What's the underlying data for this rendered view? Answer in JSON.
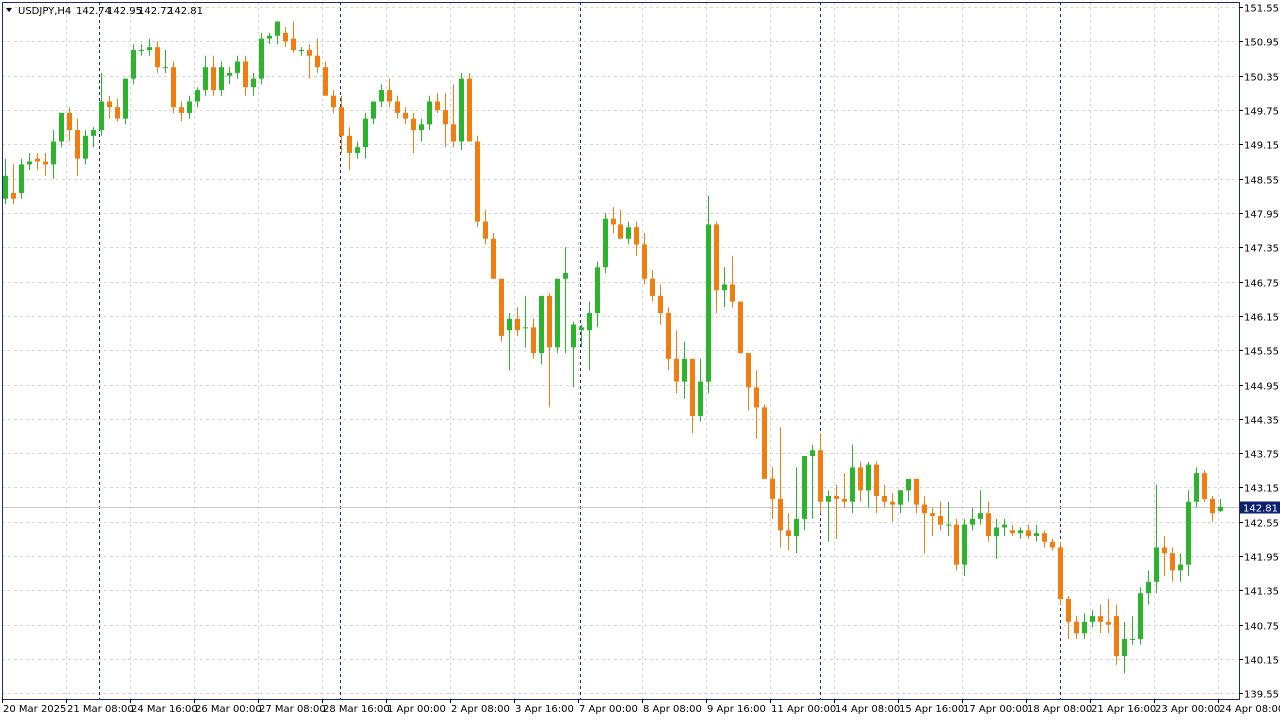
{
  "header": {
    "symbol_timeframe": "USDJPY,H4",
    "open": "142.74",
    "high": "142.95",
    "low": "142.72",
    "close": "142.81"
  },
  "colors": {
    "bull": "#2db42d",
    "bear": "#f07d0f",
    "grid": "#d9d9d9",
    "separator": "#1a2a7a",
    "price_label_bg": "#0b1f6e",
    "frame": "#1a2a7a"
  },
  "chart_data": {
    "type": "candlestick",
    "title": "USDJPY,H4",
    "ylim": [
      139.5,
      151.6
    ],
    "grid": true,
    "last_price": 142.81,
    "y_ticks": [
      "151.55",
      "150.95",
      "150.35",
      "149.75",
      "149.15",
      "148.55",
      "147.95",
      "147.35",
      "146.75",
      "146.15",
      "145.55",
      "144.95",
      "144.35",
      "143.75",
      "143.15",
      "142.55",
      "141.95",
      "141.35",
      "140.75",
      "140.15",
      "139.55"
    ],
    "x_labels": [
      "20 Mar 2025",
      "21 Mar 08:00",
      "24 Mar 16:00",
      "26 Mar 00:00",
      "27 Mar 08:00",
      "28 Mar 16:00",
      "1 Apr 00:00",
      "2 Apr 08:00",
      "3 Apr 16:00",
      "7 Apr 00:00",
      "8 Apr 08:00",
      "9 Apr 16:00",
      "11 Apr 00:00",
      "14 Apr 08:00",
      "15 Apr 16:00",
      "17 Apr 00:00",
      "18 Apr 08:00",
      "21 Apr 16:00",
      "23 Apr 00:00",
      "24 Apr 08:00"
    ],
    "candles": [
      {
        "o": 148.2,
        "h": 148.9,
        "l": 148.1,
        "c": 148.6
      },
      {
        "o": 148.3,
        "h": 148.8,
        "l": 148.1,
        "c": 148.2
      },
      {
        "o": 148.3,
        "h": 148.9,
        "l": 148.2,
        "c": 148.8
      },
      {
        "o": 148.8,
        "h": 149.0,
        "l": 148.7,
        "c": 148.85
      },
      {
        "o": 148.9,
        "h": 149.0,
        "l": 148.7,
        "c": 148.85
      },
      {
        "o": 148.85,
        "h": 149.0,
        "l": 148.6,
        "c": 148.8
      },
      {
        "o": 148.8,
        "h": 149.4,
        "l": 148.55,
        "c": 149.2
      },
      {
        "o": 149.2,
        "h": 149.7,
        "l": 149.1,
        "c": 149.7
      },
      {
        "o": 149.7,
        "h": 149.8,
        "l": 149.2,
        "c": 149.4
      },
      {
        "o": 149.4,
        "h": 149.6,
        "l": 148.6,
        "c": 148.9
      },
      {
        "o": 148.9,
        "h": 149.4,
        "l": 148.8,
        "c": 149.3
      },
      {
        "o": 149.3,
        "h": 149.45,
        "l": 149.1,
        "c": 149.4
      },
      {
        "o": 149.4,
        "h": 150.4,
        "l": 149.3,
        "c": 149.9
      },
      {
        "o": 149.9,
        "h": 150.0,
        "l": 149.6,
        "c": 149.8
      },
      {
        "o": 149.8,
        "h": 149.95,
        "l": 149.55,
        "c": 149.6
      },
      {
        "o": 149.6,
        "h": 150.3,
        "l": 149.5,
        "c": 150.3
      },
      {
        "o": 150.3,
        "h": 150.9,
        "l": 150.2,
        "c": 150.8
      },
      {
        "o": 150.8,
        "h": 150.9,
        "l": 150.7,
        "c": 150.8
      },
      {
        "o": 150.8,
        "h": 151.0,
        "l": 150.7,
        "c": 150.85
      },
      {
        "o": 150.85,
        "h": 150.95,
        "l": 150.4,
        "c": 150.5
      },
      {
        "o": 150.5,
        "h": 150.8,
        "l": 150.4,
        "c": 150.5
      },
      {
        "o": 150.5,
        "h": 150.6,
        "l": 149.7,
        "c": 149.8
      },
      {
        "o": 149.8,
        "h": 149.9,
        "l": 149.55,
        "c": 149.7
      },
      {
        "o": 149.7,
        "h": 150.0,
        "l": 149.6,
        "c": 149.9
      },
      {
        "o": 149.9,
        "h": 150.15,
        "l": 149.8,
        "c": 150.1
      },
      {
        "o": 150.1,
        "h": 150.7,
        "l": 150.0,
        "c": 150.5
      },
      {
        "o": 150.5,
        "h": 150.7,
        "l": 150.0,
        "c": 150.1
      },
      {
        "o": 150.1,
        "h": 150.6,
        "l": 150.0,
        "c": 150.5
      },
      {
        "o": 150.35,
        "h": 150.5,
        "l": 150.2,
        "c": 150.4
      },
      {
        "o": 150.4,
        "h": 150.7,
        "l": 150.3,
        "c": 150.6
      },
      {
        "o": 150.6,
        "h": 150.7,
        "l": 150.0,
        "c": 150.15
      },
      {
        "o": 150.15,
        "h": 150.4,
        "l": 150.0,
        "c": 150.3
      },
      {
        "o": 150.3,
        "h": 151.1,
        "l": 150.2,
        "c": 151.0
      },
      {
        "o": 151.0,
        "h": 151.1,
        "l": 150.9,
        "c": 151.05
      },
      {
        "o": 151.05,
        "h": 151.3,
        "l": 150.9,
        "c": 151.3
      },
      {
        "o": 151.1,
        "h": 151.2,
        "l": 150.85,
        "c": 150.95
      },
      {
        "o": 151.0,
        "h": 151.3,
        "l": 150.75,
        "c": 150.8
      },
      {
        "o": 150.8,
        "h": 150.85,
        "l": 150.7,
        "c": 150.8
      },
      {
        "o": 150.8,
        "h": 150.9,
        "l": 150.3,
        "c": 150.7
      },
      {
        "o": 150.7,
        "h": 151.0,
        "l": 150.4,
        "c": 150.5
      },
      {
        "o": 150.5,
        "h": 150.6,
        "l": 150.0,
        "c": 150.0
      },
      {
        "o": 150.0,
        "h": 150.1,
        "l": 149.7,
        "c": 149.8
      },
      {
        "o": 149.8,
        "h": 150.0,
        "l": 149.0,
        "c": 149.3
      },
      {
        "o": 149.3,
        "h": 149.45,
        "l": 148.7,
        "c": 149.0
      },
      {
        "o": 149.0,
        "h": 149.2,
        "l": 148.9,
        "c": 149.1
      },
      {
        "o": 149.1,
        "h": 149.7,
        "l": 148.9,
        "c": 149.6
      },
      {
        "o": 149.6,
        "h": 149.9,
        "l": 149.5,
        "c": 149.9
      },
      {
        "o": 149.9,
        "h": 150.2,
        "l": 149.8,
        "c": 150.1
      },
      {
        "o": 150.1,
        "h": 150.3,
        "l": 149.8,
        "c": 149.9
      },
      {
        "o": 149.9,
        "h": 150.0,
        "l": 149.6,
        "c": 149.7
      },
      {
        "o": 149.7,
        "h": 149.8,
        "l": 149.5,
        "c": 149.6
      },
      {
        "o": 149.6,
        "h": 149.7,
        "l": 149.0,
        "c": 149.4
      },
      {
        "o": 149.4,
        "h": 149.6,
        "l": 149.2,
        "c": 149.5
      },
      {
        "o": 149.5,
        "h": 150.0,
        "l": 149.4,
        "c": 149.9
      },
      {
        "o": 149.9,
        "h": 150.05,
        "l": 149.7,
        "c": 149.75
      },
      {
        "o": 149.75,
        "h": 150.05,
        "l": 149.1,
        "c": 149.5
      },
      {
        "o": 149.5,
        "h": 150.2,
        "l": 149.1,
        "c": 149.2
      },
      {
        "o": 149.2,
        "h": 150.4,
        "l": 149.05,
        "c": 150.3
      },
      {
        "o": 150.3,
        "h": 150.4,
        "l": 149.2,
        "c": 149.2
      },
      {
        "o": 149.2,
        "h": 149.3,
        "l": 147.7,
        "c": 147.8
      },
      {
        "o": 147.8,
        "h": 148.0,
        "l": 147.4,
        "c": 147.5
      },
      {
        "o": 147.5,
        "h": 147.6,
        "l": 146.8,
        "c": 146.8
      },
      {
        "o": 146.8,
        "h": 146.8,
        "l": 145.7,
        "c": 145.8
      },
      {
        "o": 145.9,
        "h": 146.2,
        "l": 145.2,
        "c": 146.1
      },
      {
        "o": 146.1,
        "h": 146.3,
        "l": 145.8,
        "c": 145.9
      },
      {
        "o": 145.95,
        "h": 146.5,
        "l": 145.6,
        "c": 145.95
      },
      {
        "o": 145.95,
        "h": 146.1,
        "l": 145.4,
        "c": 145.5
      },
      {
        "o": 145.5,
        "h": 146.5,
        "l": 145.3,
        "c": 146.5
      },
      {
        "o": 146.5,
        "h": 146.55,
        "l": 144.55,
        "c": 145.6
      },
      {
        "o": 145.6,
        "h": 146.8,
        "l": 145.5,
        "c": 146.8
      },
      {
        "o": 146.8,
        "h": 147.35,
        "l": 145.5,
        "c": 146.9
      },
      {
        "o": 145.6,
        "h": 146.05,
        "l": 144.9,
        "c": 146.0
      },
      {
        "o": 145.9,
        "h": 146.0,
        "l": 145.6,
        "c": 145.95
      },
      {
        "o": 145.9,
        "h": 146.4,
        "l": 145.2,
        "c": 146.2
      },
      {
        "o": 146.2,
        "h": 147.1,
        "l": 145.95,
        "c": 147.0
      },
      {
        "o": 147.0,
        "h": 147.95,
        "l": 146.9,
        "c": 147.85
      },
      {
        "o": 147.85,
        "h": 148.05,
        "l": 147.6,
        "c": 147.75
      },
      {
        "o": 147.75,
        "h": 148.0,
        "l": 147.5,
        "c": 147.5
      },
      {
        "o": 147.5,
        "h": 147.8,
        "l": 147.4,
        "c": 147.7
      },
      {
        "o": 147.7,
        "h": 147.8,
        "l": 147.2,
        "c": 147.4
      },
      {
        "o": 147.4,
        "h": 147.6,
        "l": 146.7,
        "c": 146.8
      },
      {
        "o": 146.8,
        "h": 146.95,
        "l": 146.4,
        "c": 146.5
      },
      {
        "o": 146.5,
        "h": 146.7,
        "l": 146.0,
        "c": 146.2
      },
      {
        "o": 146.2,
        "h": 146.3,
        "l": 145.2,
        "c": 145.4
      },
      {
        "o": 145.4,
        "h": 145.9,
        "l": 144.8,
        "c": 145.0
      },
      {
        "o": 145.0,
        "h": 145.7,
        "l": 144.7,
        "c": 145.4
      },
      {
        "o": 145.4,
        "h": 145.4,
        "l": 144.1,
        "c": 144.4
      },
      {
        "o": 144.4,
        "h": 145.4,
        "l": 144.3,
        "c": 145.0
      },
      {
        "o": 145.0,
        "h": 148.25,
        "l": 144.8,
        "c": 147.75
      },
      {
        "o": 147.75,
        "h": 147.8,
        "l": 146.2,
        "c": 146.6
      },
      {
        "o": 146.6,
        "h": 147.0,
        "l": 146.3,
        "c": 146.7
      },
      {
        "o": 146.7,
        "h": 147.2,
        "l": 146.3,
        "c": 146.4
      },
      {
        "o": 146.4,
        "h": 146.4,
        "l": 145.5,
        "c": 145.5
      },
      {
        "o": 145.5,
        "h": 145.5,
        "l": 144.5,
        "c": 144.9
      },
      {
        "o": 144.9,
        "h": 145.2,
        "l": 144.0,
        "c": 144.55
      },
      {
        "o": 144.55,
        "h": 144.6,
        "l": 143.3,
        "c": 143.3
      },
      {
        "o": 143.3,
        "h": 143.5,
        "l": 142.6,
        "c": 142.95
      },
      {
        "o": 142.95,
        "h": 144.2,
        "l": 142.1,
        "c": 142.4
      },
      {
        "o": 142.4,
        "h": 142.7,
        "l": 142.05,
        "c": 142.3
      },
      {
        "o": 142.3,
        "h": 143.5,
        "l": 142.0,
        "c": 142.6
      },
      {
        "o": 142.6,
        "h": 143.7,
        "l": 142.4,
        "c": 143.7
      },
      {
        "o": 143.7,
        "h": 143.9,
        "l": 142.6,
        "c": 143.8
      },
      {
        "o": 143.8,
        "h": 144.1,
        "l": 142.7,
        "c": 142.9
      },
      {
        "o": 142.9,
        "h": 143.1,
        "l": 142.2,
        "c": 143.0
      },
      {
        "o": 143.0,
        "h": 143.2,
        "l": 142.25,
        "c": 142.95
      },
      {
        "o": 142.95,
        "h": 143.4,
        "l": 142.8,
        "c": 142.9
      },
      {
        "o": 142.9,
        "h": 143.9,
        "l": 142.7,
        "c": 143.5
      },
      {
        "o": 143.5,
        "h": 143.6,
        "l": 142.9,
        "c": 143.1
      },
      {
        "o": 143.1,
        "h": 143.6,
        "l": 142.8,
        "c": 143.55
      },
      {
        "o": 143.55,
        "h": 143.6,
        "l": 142.7,
        "c": 143.0
      },
      {
        "o": 143.0,
        "h": 143.2,
        "l": 142.8,
        "c": 142.9
      },
      {
        "o": 142.9,
        "h": 143.05,
        "l": 142.55,
        "c": 142.85
      },
      {
        "o": 142.85,
        "h": 143.1,
        "l": 142.7,
        "c": 143.1
      },
      {
        "o": 143.1,
        "h": 143.3,
        "l": 142.9,
        "c": 143.3
      },
      {
        "o": 143.3,
        "h": 143.3,
        "l": 142.7,
        "c": 142.85
      },
      {
        "o": 142.85,
        "h": 143.0,
        "l": 142.0,
        "c": 142.7
      },
      {
        "o": 142.7,
        "h": 142.8,
        "l": 142.3,
        "c": 142.65
      },
      {
        "o": 142.65,
        "h": 142.9,
        "l": 142.4,
        "c": 142.5
      },
      {
        "o": 142.5,
        "h": 142.9,
        "l": 142.3,
        "c": 142.5
      },
      {
        "o": 142.5,
        "h": 142.6,
        "l": 141.7,
        "c": 141.8
      },
      {
        "o": 141.8,
        "h": 142.6,
        "l": 141.6,
        "c": 142.5
      },
      {
        "o": 142.5,
        "h": 142.8,
        "l": 142.4,
        "c": 142.6
      },
      {
        "o": 142.6,
        "h": 143.1,
        "l": 142.5,
        "c": 142.7
      },
      {
        "o": 142.7,
        "h": 142.9,
        "l": 142.2,
        "c": 142.3
      },
      {
        "o": 142.3,
        "h": 142.6,
        "l": 141.9,
        "c": 142.45
      },
      {
        "o": 142.45,
        "h": 142.6,
        "l": 142.3,
        "c": 142.5
      },
      {
        "o": 142.4,
        "h": 142.5,
        "l": 142.3,
        "c": 142.35
      },
      {
        "o": 142.35,
        "h": 142.45,
        "l": 142.25,
        "c": 142.4
      },
      {
        "o": 142.4,
        "h": 142.5,
        "l": 142.25,
        "c": 142.3
      },
      {
        "o": 142.3,
        "h": 142.5,
        "l": 142.2,
        "c": 142.35
      },
      {
        "o": 142.35,
        "h": 142.4,
        "l": 142.1,
        "c": 142.2
      },
      {
        "o": 142.2,
        "h": 142.25,
        "l": 142.05,
        "c": 142.1
      },
      {
        "o": 142.1,
        "h": 142.2,
        "l": 141.1,
        "c": 141.2
      },
      {
        "o": 141.2,
        "h": 141.25,
        "l": 140.5,
        "c": 140.8
      },
      {
        "o": 140.8,
        "h": 140.9,
        "l": 140.5,
        "c": 140.6
      },
      {
        "o": 140.6,
        "h": 140.95,
        "l": 140.5,
        "c": 140.8
      },
      {
        "o": 140.8,
        "h": 141.0,
        "l": 140.7,
        "c": 140.9
      },
      {
        "o": 140.9,
        "h": 141.1,
        "l": 140.6,
        "c": 140.8
      },
      {
        "o": 140.8,
        "h": 141.2,
        "l": 140.6,
        "c": 140.75
      },
      {
        "o": 140.9,
        "h": 141.1,
        "l": 140.05,
        "c": 140.2
      },
      {
        "o": 140.2,
        "h": 140.8,
        "l": 139.9,
        "c": 140.5
      },
      {
        "o": 140.5,
        "h": 140.9,
        "l": 140.4,
        "c": 140.5
      },
      {
        "o": 140.5,
        "h": 141.4,
        "l": 140.4,
        "c": 141.3
      },
      {
        "o": 141.3,
        "h": 141.7,
        "l": 141.1,
        "c": 141.5
      },
      {
        "o": 141.5,
        "h": 143.2,
        "l": 141.3,
        "c": 142.1
      },
      {
        "o": 142.1,
        "h": 142.3,
        "l": 141.6,
        "c": 142.0
      },
      {
        "o": 142.0,
        "h": 142.1,
        "l": 141.5,
        "c": 141.7
      },
      {
        "o": 141.7,
        "h": 142.0,
        "l": 141.5,
        "c": 141.8
      },
      {
        "o": 141.8,
        "h": 143.1,
        "l": 141.6,
        "c": 142.9
      },
      {
        "o": 142.9,
        "h": 143.5,
        "l": 142.8,
        "c": 143.4
      },
      {
        "o": 143.4,
        "h": 143.45,
        "l": 142.9,
        "c": 142.95
      },
      {
        "o": 142.95,
        "h": 143.0,
        "l": 142.55,
        "c": 142.7
      },
      {
        "o": 142.74,
        "h": 142.95,
        "l": 142.72,
        "c": 142.81
      }
    ]
  }
}
